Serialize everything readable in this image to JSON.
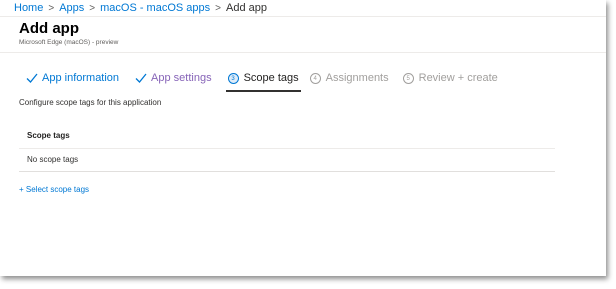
{
  "breadcrumb": {
    "items": [
      {
        "label": "Home"
      },
      {
        "label": "Apps"
      },
      {
        "label": "macOS - macOS apps"
      },
      {
        "label": "Add app"
      }
    ],
    "separator": ">"
  },
  "page": {
    "title": "Add app",
    "subtitle": "Microsoft Edge (macOS) - preview"
  },
  "wizard": {
    "steps": [
      {
        "label": "App information",
        "state": "done",
        "icon": "check-icon"
      },
      {
        "label": "App settings",
        "state": "done",
        "icon": "check-icon"
      },
      {
        "number": "3",
        "label": "Scope tags",
        "state": "current"
      },
      {
        "number": "4",
        "label": "Assignments",
        "state": "upcoming"
      },
      {
        "number": "5",
        "label": "Review + create",
        "state": "upcoming"
      }
    ]
  },
  "content": {
    "intro": "Configure scope tags for this application",
    "table": {
      "header": "Scope tags",
      "rows": [
        "No scope tags"
      ]
    },
    "select_link": "+ Select scope tags"
  },
  "colors": {
    "accent": "#0078d4",
    "visited": "#8764b8",
    "disabled": "#a19f9d",
    "text": "#323130"
  }
}
